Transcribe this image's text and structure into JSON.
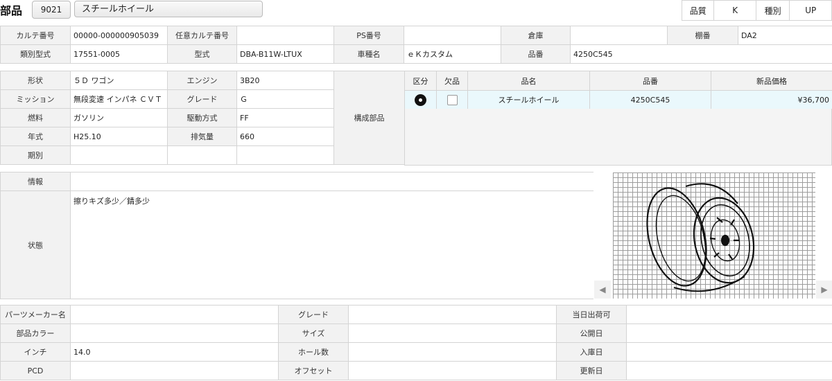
{
  "header": {
    "title": "部品",
    "code": "9021",
    "part_name": "スチールホイール",
    "quality_label": "品質",
    "quality_value": "K",
    "type_label": "種別",
    "type_value": "UP"
  },
  "info1": {
    "row1": [
      {
        "label": "カルテ番号",
        "value": "00000-000000905039"
      },
      {
        "label": "任意カルテ番号",
        "value": ""
      },
      {
        "label": "PS番号",
        "value": ""
      },
      {
        "label": "倉庫",
        "value": ""
      },
      {
        "label": "棚番",
        "value": "DA2"
      }
    ],
    "row2": [
      {
        "label": "類別型式",
        "value": "17551-0005"
      },
      {
        "label": "型式",
        "value": "DBA-B11W-LTUX"
      },
      {
        "label": "車種名",
        "value": "ｅＫカスタム"
      },
      {
        "label": "品番",
        "value": "4250C545"
      }
    ]
  },
  "vehicle": {
    "rows": [
      {
        "l1": "形状",
        "v1": "５Ｄ ワゴン",
        "l2": "エンジン",
        "v2": "3B20"
      },
      {
        "l1": "ミッション",
        "v1": "無段変速 インパネ ＣＶＴ",
        "l2": "グレード",
        "v2": "Ｇ"
      },
      {
        "l1": "燃料",
        "v1": "ガソリン",
        "l2": "駆動方式",
        "v2": "FF"
      },
      {
        "l1": "年式",
        "v1": "H25.10",
        "l2": "排気量",
        "v2": "660"
      },
      {
        "l1": "期別",
        "v1": "",
        "l2": "",
        "v2": ""
      }
    ],
    "components_label": "構成部品"
  },
  "parts_table": {
    "headers": [
      "区分",
      "欠品",
      "品名",
      "品番",
      "新品価格"
    ],
    "rows": [
      {
        "category_icon": "disc-icon",
        "missing": false,
        "name": "スチールホイール",
        "number": "4250C545",
        "price": "¥36,700"
      }
    ]
  },
  "notes": {
    "info_label": "情報",
    "info_value": "",
    "condition_label": "状態",
    "condition_value": "擦りキズ多少／錆多少"
  },
  "image_viewer": {
    "image_icon": "steel-wheel-drawing",
    "prev_glyph": "◀",
    "next_glyph": "▶"
  },
  "specs": {
    "rows": [
      {
        "l1": "パーツメーカー名",
        "v1": "",
        "l2": "グレード",
        "v2": "",
        "l3": "当日出荷可",
        "v3": ""
      },
      {
        "l1": "部品カラー",
        "v1": "",
        "l2": "サイズ",
        "v2": "",
        "l3": "公開日",
        "v3": ""
      },
      {
        "l1": "インチ",
        "v1": "14.0",
        "l2": "ホール数",
        "v2": "",
        "l3": "入庫日",
        "v3": ""
      },
      {
        "l1": "PCD",
        "v1": "",
        "l2": "オフセット",
        "v2": "",
        "l3": "更新日",
        "v3": ""
      }
    ]
  }
}
